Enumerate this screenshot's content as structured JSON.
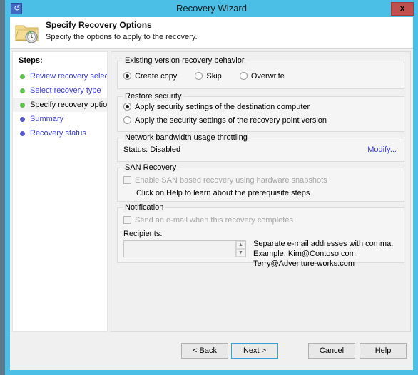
{
  "window": {
    "title": "Recovery Wizard",
    "icon": "recovery-clock-icon",
    "close_label": "x"
  },
  "header": {
    "title": "Specify Recovery Options",
    "subtitle": "Specify the options to apply to the recovery.",
    "icon": "folder-clock-icon"
  },
  "sidebar": {
    "title": "Steps:",
    "items": [
      {
        "label": "Review recovery selection",
        "state": "done"
      },
      {
        "label": "Select recovery type",
        "state": "done"
      },
      {
        "label": "Specify recovery options",
        "state": "current"
      },
      {
        "label": "Summary",
        "state": "pending"
      },
      {
        "label": "Recovery status",
        "state": "pending"
      }
    ]
  },
  "main": {
    "existing_version": {
      "title": "Existing version recovery behavior",
      "options": [
        {
          "label": "Create copy",
          "checked": true
        },
        {
          "label": "Skip",
          "checked": false
        },
        {
          "label": "Overwrite",
          "checked": false
        }
      ]
    },
    "restore_security": {
      "title": "Restore security",
      "options": [
        {
          "label": "Apply security settings of the destination computer",
          "checked": true
        },
        {
          "label": "Apply the security settings of the recovery point version",
          "checked": false
        }
      ]
    },
    "network_throttling": {
      "title": "Network bandwidth usage throttling",
      "status": "Status: Disabled",
      "modify_link": "Modify..."
    },
    "san_recovery": {
      "title": "SAN Recovery",
      "checkbox_label": "Enable SAN based recovery using hardware snapshots",
      "checkbox_checked": false,
      "checkbox_disabled": true,
      "hint": "Click on Help to learn about the prerequisite steps"
    },
    "notification": {
      "title": "Notification",
      "checkbox_label": "Send an e-mail when this recovery completes",
      "checkbox_checked": false,
      "checkbox_disabled": true,
      "recipients_label": "Recipients:",
      "recipients_value": "",
      "recipients_placeholder": "",
      "hint_line1": "Separate e-mail addresses with comma.",
      "hint_line2": "Example: Kim@Contoso.com, Terry@Adventure-works.com"
    }
  },
  "buttons": {
    "back": "< Back",
    "next": "Next >",
    "cancel": "Cancel",
    "help": "Help"
  },
  "colors": {
    "titlebar": "#4cbfe6",
    "close_button": "#c0504d",
    "link": "#3b3bdc",
    "step_done": "#5fc14e",
    "step_pending": "#5a5ad0",
    "default_button_border": "#3c9fd8"
  }
}
